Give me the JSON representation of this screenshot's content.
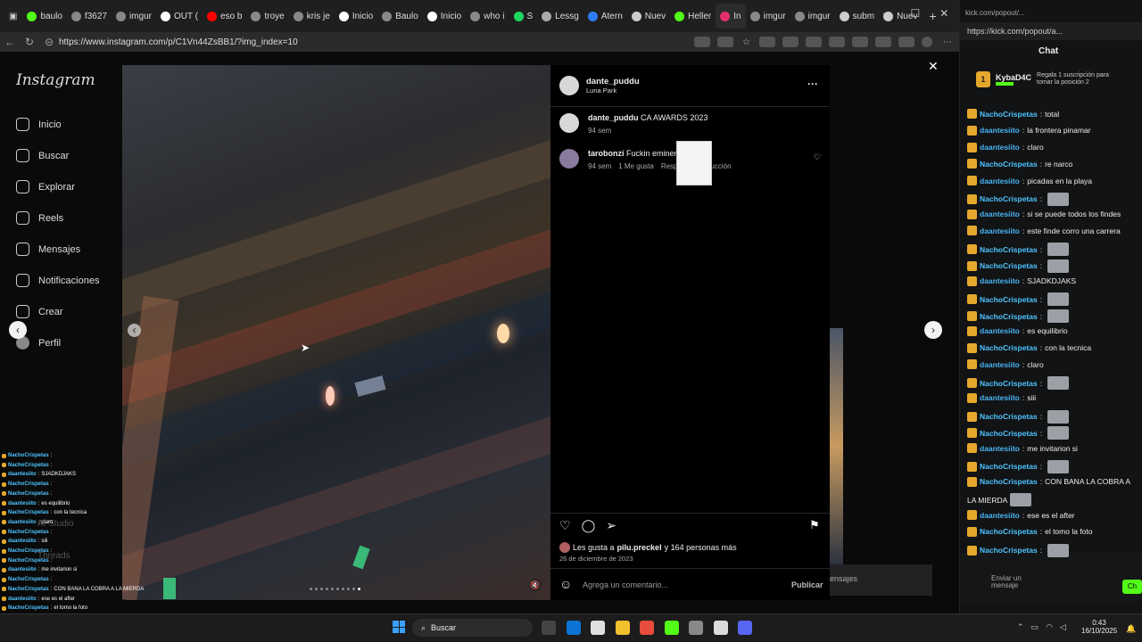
{
  "browser": {
    "tabs": [
      {
        "label": "baulo",
        "color": "#53fc18"
      },
      {
        "label": "f3627",
        "color": "#888"
      },
      {
        "label": "imgur",
        "color": "#888"
      },
      {
        "label": "OUT (",
        "color": "#fff"
      },
      {
        "label": "eso b",
        "color": "#ff0000"
      },
      {
        "label": "troye",
        "color": "#888"
      },
      {
        "label": "kris je",
        "color": "#888"
      },
      {
        "label": "Inicio",
        "color": "#fff"
      },
      {
        "label": "Baulo",
        "color": "#888"
      },
      {
        "label": "Inicio",
        "color": "#fff"
      },
      {
        "label": "who i",
        "color": "#888"
      },
      {
        "label": "S",
        "color": "#1ed760"
      },
      {
        "label": "Lessg",
        "color": "#aaa"
      },
      {
        "label": "Atern",
        "color": "#2e7df6"
      },
      {
        "label": "Nuev",
        "color": "#ccc"
      },
      {
        "label": "Heller",
        "color": "#53fc18"
      },
      {
        "label": "In",
        "color": "#e1306c",
        "active": true
      },
      {
        "label": "imgur",
        "color": "#888"
      },
      {
        "label": "imgur",
        "color": "#888"
      },
      {
        "label": "subm",
        "color": "#ccc"
      },
      {
        "label": "Nuev",
        "color": "#ccc"
      }
    ],
    "new_tab_label": "+",
    "url": "https://www.instagram.com/p/C1Vn44ZsBB1/?img_index=10",
    "window_controls": {
      "minimize": "─",
      "maximize": "☐",
      "close": "✕"
    }
  },
  "instagram": {
    "logo": "Instagram",
    "nav": [
      {
        "label": "Inicio",
        "icon": "home-icon"
      },
      {
        "label": "Buscar",
        "icon": "search-icon"
      },
      {
        "label": "Explorar",
        "icon": "explore-icon"
      },
      {
        "label": "Reels",
        "icon": "reels-icon"
      },
      {
        "label": "Mensajes",
        "icon": "messages-icon"
      },
      {
        "label": "Notificaciones",
        "icon": "heart-icon"
      },
      {
        "label": "Crear",
        "icon": "plus-icon"
      },
      {
        "label": "Perfil",
        "icon": "avatar"
      }
    ],
    "faded_nav": [
      "AI Studio",
      "Threads"
    ],
    "close_label": "✕",
    "post": {
      "username": "dante_puddu",
      "location": "Luna Park",
      "more_label": "···",
      "caption_user": "dante_puddu",
      "caption_text": "CA AWARDS 2023",
      "caption_time": "94 sem",
      "comment_user": "tarobonzi",
      "comment_text": "Fuckin eminenc",
      "comment_time": "94 sem",
      "comment_likes": "1 Me gusta",
      "comment_reply": "Respo",
      "comment_translate": "ducción",
      "likes_prefix": "Les gusta a ",
      "likes_user": "pilu.preckel",
      "likes_suffix": " y 164 personas más",
      "date": "26 de diciembre de 2023",
      "comment_placeholder": "Agrega un comentario...",
      "publish_label": "Publicar",
      "media_arrow_prev": "‹",
      "post_arrow_prev": "‹",
      "post_arrow_next": "›",
      "mute_icon": "🔇",
      "carousel_dots": 10,
      "carousel_active": 9
    },
    "background_text": "ensajes"
  },
  "kick": {
    "url": "https://kick.com/popout/a...",
    "title": "Chat",
    "pinned_user": "KybaD4C",
    "pinned_count": "1",
    "pinned_text": "Regala 1 suscripción para tomar la posición 2",
    "messages": [
      {
        "user": "NachoCrispetas",
        "text": "total",
        "u": 1
      },
      {
        "user": "daantesiito",
        "text": "la frontera pinamar",
        "u": 2
      },
      {
        "user": "daantesiito",
        "text": "claro",
        "u": 2
      },
      {
        "user": "NachoCrispetas",
        "text": "re narco",
        "u": 1
      },
      {
        "user": "daantesiito",
        "text": "picadas en la playa",
        "u": 2
      },
      {
        "user": "NachoCrispetas",
        "text": "",
        "u": 1,
        "emote": true
      },
      {
        "user": "daantesiito",
        "text": "si se puede todos los findes",
        "u": 2
      },
      {
        "user": "daantesiito",
        "text": "este finde corro una carrera",
        "u": 2
      },
      {
        "user": "NachoCrispetas",
        "text": "",
        "u": 1,
        "emote": true
      },
      {
        "user": "NachoCrispetas",
        "text": "",
        "u": 1,
        "emote": true
      },
      {
        "user": "daantesiito",
        "text": "SJADKDJAKS",
        "u": 2
      },
      {
        "user": "NachoCrispetas",
        "text": "",
        "u": 1,
        "emote": true
      },
      {
        "user": "NachoCrispetas",
        "text": "",
        "u": 1,
        "emote": true
      },
      {
        "user": "daantesiito",
        "text": "es equilibrio",
        "u": 2
      },
      {
        "user": "NachoCrispetas",
        "text": "con la tecnica",
        "u": 1
      },
      {
        "user": "daantesiito",
        "text": "claro",
        "u": 2
      },
      {
        "user": "NachoCrispetas",
        "text": "",
        "u": 1,
        "emote": true
      },
      {
        "user": "daantesiito",
        "text": "siii",
        "u": 2
      },
      {
        "user": "NachoCrispetas",
        "text": "",
        "u": 1,
        "emote": true
      },
      {
        "user": "NachoCrispetas",
        "text": "",
        "u": 1,
        "emote": true
      },
      {
        "user": "daantesiito",
        "text": "me invitarion si",
        "u": 2
      },
      {
        "user": "NachoCrispetas",
        "text": "",
        "u": 1,
        "emote": true
      },
      {
        "user": "NachoCrispetas",
        "text": "CON BANA LA COBRA A",
        "u": 1
      },
      {
        "user": "",
        "text": "LA MIERDA",
        "u": 0,
        "emote": true
      },
      {
        "user": "daantesiito",
        "text": "ese es el after",
        "u": 2
      },
      {
        "user": "NachoCrispetas",
        "text": "el tomo la foto",
        "u": 1
      },
      {
        "user": "NachoCrispetas",
        "text": "",
        "u": 1,
        "emote": true
      }
    ],
    "send_label": "Enviar un mensaje",
    "chat_button": "Ch"
  },
  "overlay_chat": [
    {
      "user": "NachoCrispetas",
      "text": ""
    },
    {
      "user": "NachoCrispetas",
      "text": ""
    },
    {
      "user": "daantesiito",
      "text": "SJADKDJAKS"
    },
    {
      "user": "NachoCrispetas",
      "text": ""
    },
    {
      "user": "NachoCrispetas",
      "text": ""
    },
    {
      "user": "daantesiito",
      "text": "es equilibrio"
    },
    {
      "user": "NachoCrispetas",
      "text": "con la tecnica"
    },
    {
      "user": "daantesiito",
      "text": "claro"
    },
    {
      "user": "NachoCrispetas",
      "text": ""
    },
    {
      "user": "daantesiito",
      "text": "siii"
    },
    {
      "user": "NachoCrispetas",
      "text": ""
    },
    {
      "user": "NachoCrispetas",
      "text": ""
    },
    {
      "user": "daantesiito",
      "text": "me invitarion si"
    },
    {
      "user": "NachoCrispetas",
      "text": ""
    },
    {
      "user": "NachoCrispetas",
      "text": "CON BANA LA COBRA A LA MIERDA"
    },
    {
      "user": "daantesiito",
      "text": "ese es el after"
    },
    {
      "user": "NachoCrispetas",
      "text": "el tomo la foto"
    },
    {
      "user": "NachoCrispetas",
      "text": ""
    }
  ],
  "taskbar": {
    "search_label": "Buscar",
    "time": "0:43",
    "date": "16/10/2025",
    "apps": [
      "#444",
      "#0b74d4",
      "#e0e0e0",
      "#f2c12e",
      "#e74c3c",
      "#53fc18",
      "#888",
      "#ddd",
      "#5865f2"
    ]
  }
}
